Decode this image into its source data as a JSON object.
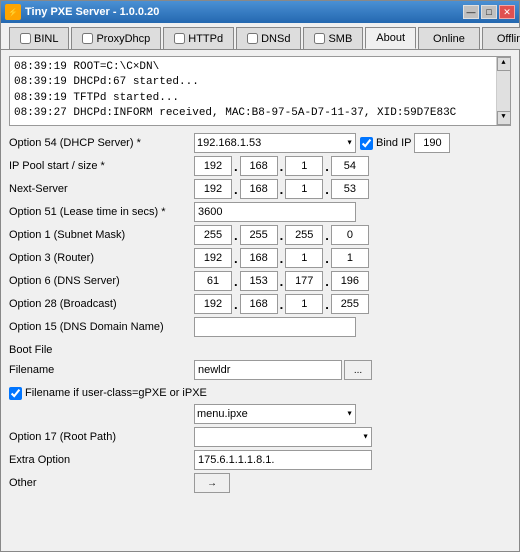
{
  "window": {
    "title": "Tiny PXE Server - 1.0.0.20",
    "icon": "⚡"
  },
  "title_buttons": {
    "minimize": "—",
    "maximize": "□",
    "close": "✕"
  },
  "tabs": [
    {
      "id": "binl",
      "label": "BINL",
      "hasCheckbox": true,
      "checked": false,
      "active": false
    },
    {
      "id": "proxydhcp",
      "label": "ProxyDhcp",
      "hasCheckbox": true,
      "checked": false,
      "active": false
    },
    {
      "id": "httpd",
      "label": "HTTPd",
      "hasCheckbox": true,
      "checked": false,
      "active": false
    },
    {
      "id": "dnsd",
      "label": "DNSd",
      "hasCheckbox": true,
      "checked": false,
      "active": false
    },
    {
      "id": "smb",
      "label": "SMB",
      "hasCheckbox": true,
      "checked": false,
      "active": false
    },
    {
      "id": "about",
      "label": "About",
      "hasCheckbox": false,
      "active": true
    },
    {
      "id": "online",
      "label": "Online",
      "hasCheckbox": false,
      "active": false
    },
    {
      "id": "offline",
      "label": "Offline",
      "hasCheckbox": false,
      "active": false
    }
  ],
  "log": {
    "lines": [
      "08:39:19 ROOT=C:\\C×DN\\",
      "08:39:19 DHCPd:67 started...",
      "08:39:19 TFTPd started...",
      "08:39:27 DHCPd:INFORM received, MAC:B8-97-5A-D7-11-37, XID:59D7E83C"
    ]
  },
  "fields": {
    "opt54_label": "Option 54 (DHCP Server) *",
    "opt54_value": "192.168.1.53",
    "bind_ip_label": "Bind IP",
    "bind_ip_value": "190",
    "ippool_label": "IP Pool start / size *",
    "ippool_ip": {
      "a": "192",
      "b": "168",
      "c": "1",
      "d": "54"
    },
    "nextserver_label": "Next-Server",
    "nextserver_ip": {
      "a": "192",
      "b": "168",
      "c": "1",
      "d": "53"
    },
    "opt51_label": "Option 51 (Lease time in secs) *",
    "opt51_value": "3600",
    "opt1_label": "Option 1  (Subnet Mask)",
    "opt1_ip": {
      "a": "255",
      "b": "255",
      "c": "255",
      "d": "0"
    },
    "opt3_label": "Option 3 (Router)",
    "opt3_ip": {
      "a": "192",
      "b": "168",
      "c": "1",
      "d": "1"
    },
    "opt6_label": "Option 6 (DNS Server)",
    "opt6_ip": {
      "a": "61",
      "b": "153",
      "c": "177",
      "d": "196"
    },
    "opt28_label": "Option 28 (Broadcast)",
    "opt28_ip": {
      "a": "192",
      "b": "168",
      "c": "1",
      "d": "255"
    },
    "opt15_label": "Option 15 (DNS Domain Name)",
    "opt15_value": "",
    "section_boot": "Boot File",
    "filename_label": "Filename",
    "filename_value": "newldr",
    "browse_label": "...",
    "cb_filename_label": "Filename if user-class=gPXE or iPXE",
    "cb_filename_checked": true,
    "menu_value": "menu.ipxe",
    "opt17_label": "Option 17 (Root Path)",
    "opt17_value": "",
    "extra_label": "Extra Option",
    "extra_value": "175.6.1.1.1.8.1.",
    "other_label": "Other",
    "other_btn": "→"
  }
}
